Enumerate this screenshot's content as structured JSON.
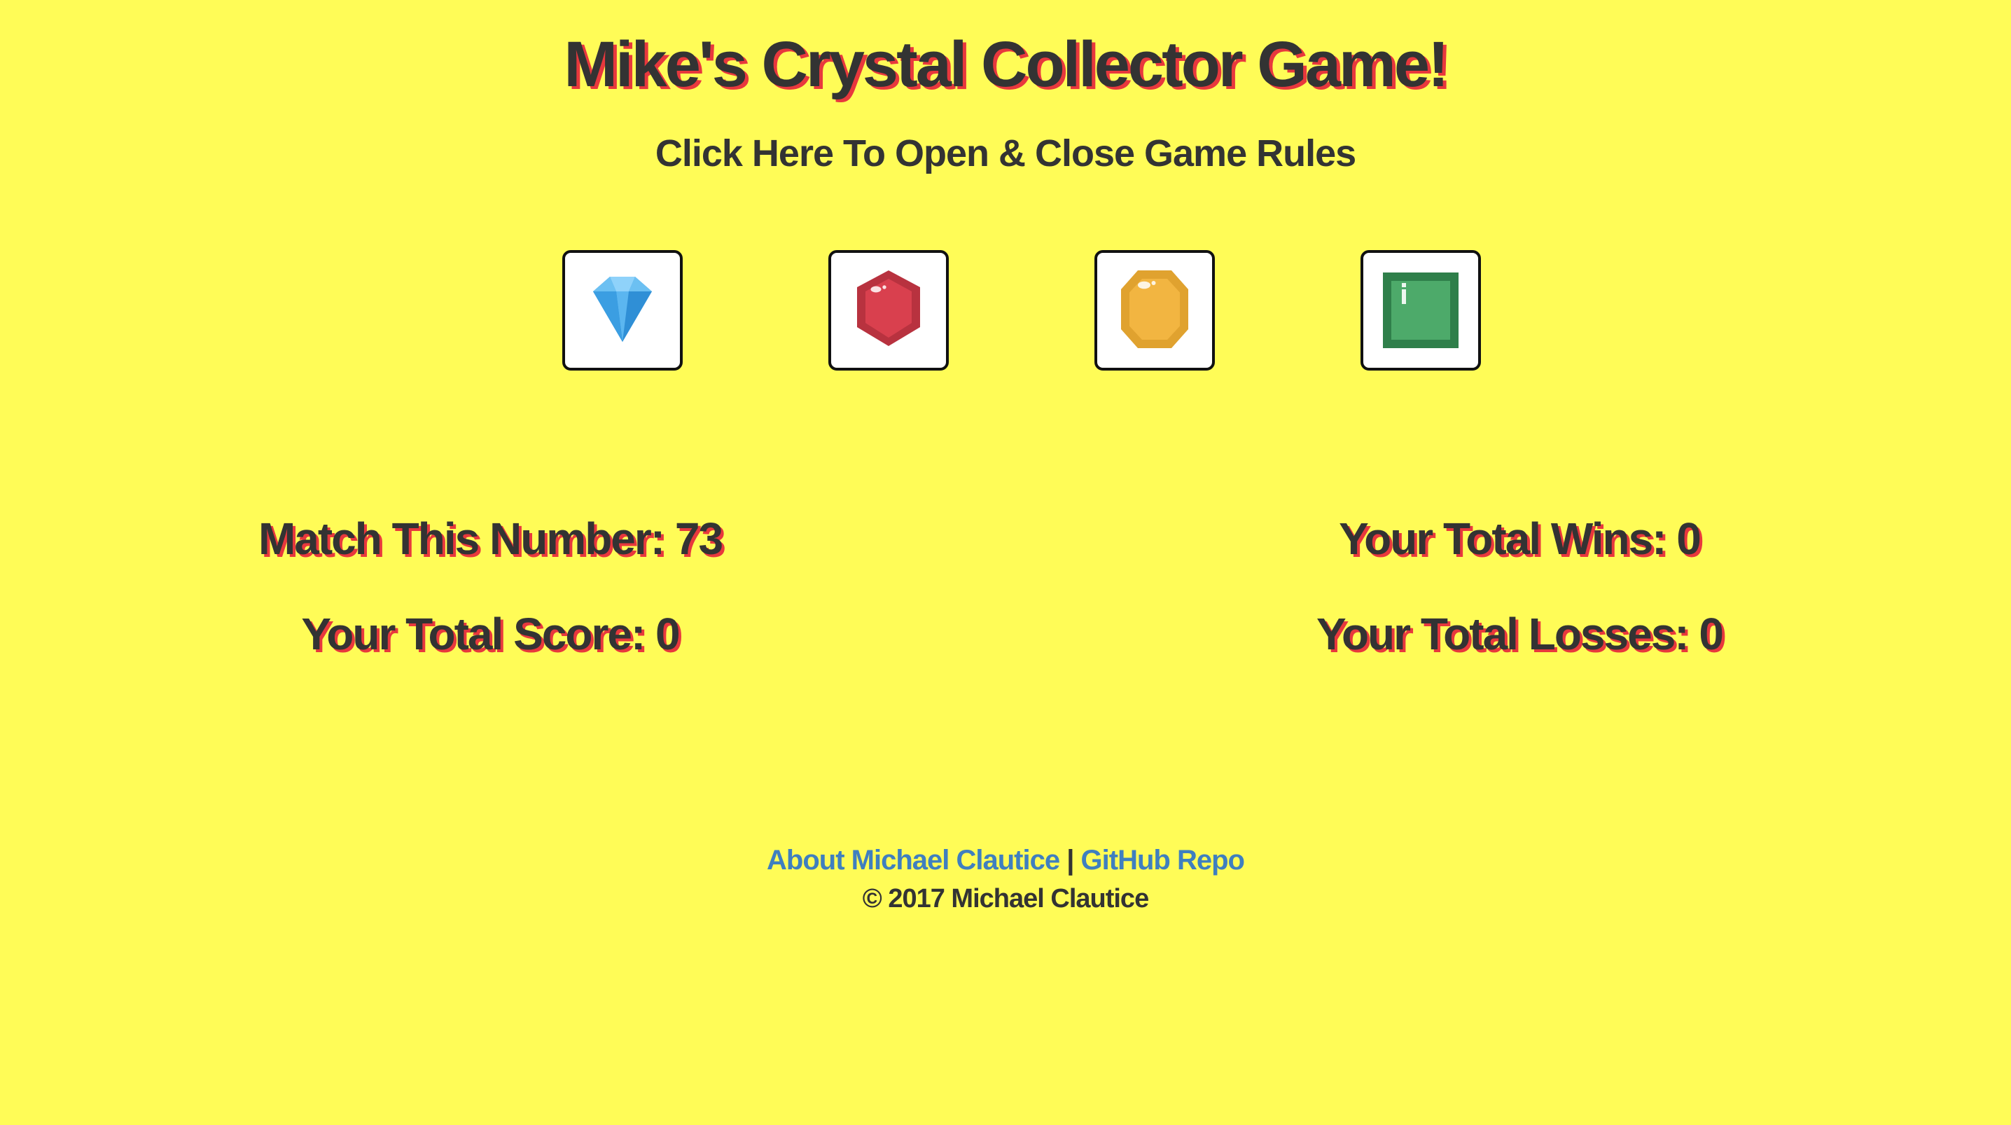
{
  "header": {
    "title": "Mike's Crystal Collector Game!",
    "rules_toggle": "Click Here To Open & Close Game Rules"
  },
  "crystals": [
    {
      "icon": "blue-diamond-icon",
      "color": "#4aa8e8"
    },
    {
      "icon": "red-ruby-icon",
      "color": "#d9404e"
    },
    {
      "icon": "yellow-topaz-icon",
      "color": "#f2b541"
    },
    {
      "icon": "green-emerald-icon",
      "color": "#4daa6a"
    }
  ],
  "stats": {
    "match_label": "Match This Number: 73",
    "score_label": "Your Total Score: 0",
    "wins_label": "Your Total Wins: 0",
    "losses_label": "Your Total Losses: 0",
    "target_number": 73,
    "score": 0,
    "wins": 0,
    "losses": 0
  },
  "footer": {
    "about_link": "About Michael Clautice",
    "separator": "|",
    "github_link": "GitHub Repo",
    "copyright": "© 2017 Michael Clautice"
  },
  "colors": {
    "background": "#fffc57",
    "text": "#333333",
    "shadow": "#e8383d",
    "link": "#3f7fbf"
  }
}
